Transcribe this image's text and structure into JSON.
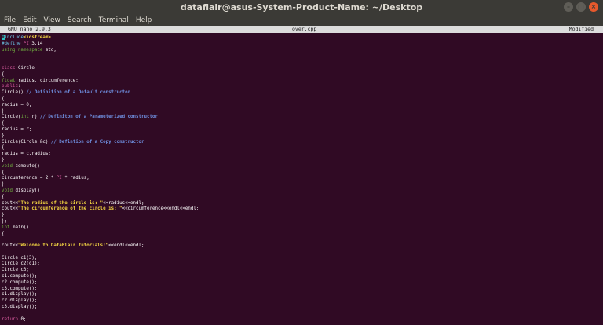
{
  "window": {
    "title": "dataflair@asus-System-Product-Name: ~/Desktop",
    "buttons": [
      "–",
      "□",
      "×"
    ]
  },
  "menu": [
    "File",
    "Edit",
    "View",
    "Search",
    "Terminal",
    "Help"
  ],
  "nano": {
    "version": "GNU nano 2.9.3",
    "filename": "over.cpp",
    "status": "Modified"
  },
  "code_lines": [
    [
      [
        "pre",
        "#include"
      ],
      [
        "str",
        "<iostream>"
      ]
    ],
    [
      [
        "pre",
        "#define "
      ],
      [
        "kw",
        "PI"
      ],
      [
        "pl",
        " 3.14"
      ]
    ],
    [
      [
        "ty",
        "using namespace"
      ],
      [
        "pl",
        " std;"
      ]
    ],
    [],
    [],
    [
      [
        "kw",
        "class"
      ],
      [
        "pl",
        " Circle"
      ]
    ],
    [
      [
        "pl",
        "{"
      ]
    ],
    [
      [
        "ty",
        "float"
      ],
      [
        "pl",
        " radius, circumference;"
      ]
    ],
    [
      [
        "kw",
        "public"
      ],
      [
        "pl",
        ":"
      ]
    ],
    [
      [
        "pl",
        "Circle() "
      ],
      [
        "cm",
        "// Definition of a Default constructor"
      ]
    ],
    [
      [
        "pl",
        "{"
      ]
    ],
    [
      [
        "pl",
        "radius = 0;"
      ]
    ],
    [
      [
        "pl",
        "}"
      ]
    ],
    [
      [
        "pl",
        "Circle("
      ],
      [
        "ty",
        "int"
      ],
      [
        "pl",
        " r) "
      ],
      [
        "cm",
        "// Definiton of a Parameterized constructor"
      ]
    ],
    [
      [
        "pl",
        "{"
      ]
    ],
    [
      [
        "pl",
        "radius = r;"
      ]
    ],
    [
      [
        "pl",
        "}"
      ]
    ],
    [
      [
        "pl",
        "Circle(Circle &c) "
      ],
      [
        "cm",
        "// Defintion of a Copy constructor"
      ]
    ],
    [
      [
        "pl",
        "{"
      ]
    ],
    [
      [
        "pl",
        "radius = c.radius;"
      ]
    ],
    [
      [
        "pl",
        "}"
      ]
    ],
    [
      [
        "ty",
        "void"
      ],
      [
        "pl",
        " compute()"
      ]
    ],
    [
      [
        "pl",
        "{"
      ]
    ],
    [
      [
        "pl",
        "circumference = 2 * "
      ],
      [
        "kw",
        "PI"
      ],
      [
        "pl",
        " * radius;"
      ]
    ],
    [
      [
        "pl",
        "}"
      ]
    ],
    [
      [
        "ty",
        "void"
      ],
      [
        "pl",
        " display()"
      ]
    ],
    [
      [
        "pl",
        "{"
      ]
    ],
    [
      [
        "pl",
        "cout<<"
      ],
      [
        "str",
        "\"The radius of the circle is: \""
      ],
      [
        "pl",
        "<<radius<<endl;"
      ]
    ],
    [
      [
        "pl",
        "cout<<"
      ],
      [
        "str",
        "\"The circumference of the circle is: \""
      ],
      [
        "pl",
        "<<circumference<<endl<<endl;"
      ]
    ],
    [
      [
        "pl",
        "}"
      ]
    ],
    [
      [
        "pl",
        "};"
      ]
    ],
    [
      [
        "ty",
        "int"
      ],
      [
        "pl",
        " main()"
      ]
    ],
    [
      [
        "pl",
        "{"
      ]
    ],
    [],
    [
      [
        "pl",
        "cout<<"
      ],
      [
        "str",
        "\"Welcome to DataFlair tutorials!\""
      ],
      [
        "pl",
        "<<endl<<endl;"
      ]
    ],
    [],
    [
      [
        "pl",
        "Circle c1(3);"
      ]
    ],
    [
      [
        "pl",
        "Circle c2(c1);"
      ]
    ],
    [
      [
        "pl",
        "Circle c3;"
      ]
    ],
    [
      [
        "pl",
        "c1.compute();"
      ]
    ],
    [
      [
        "pl",
        "c2.compute();"
      ]
    ],
    [
      [
        "pl",
        "c3.compute();"
      ]
    ],
    [
      [
        "pl",
        "c1.display();"
      ]
    ],
    [
      [
        "pl",
        "c2.display();"
      ]
    ],
    [
      [
        "pl",
        "c3.display();"
      ]
    ],
    [],
    [
      [
        "kw",
        "return"
      ],
      [
        "pl",
        " 0;"
      ]
    ],
    [
      [
        "pl",
        "}"
      ]
    ]
  ],
  "colors": {
    "terminal_bg": "#300a24",
    "titlebar_bg": "#3b3a36",
    "preprocessor": "#6fd0f0",
    "string": "#f5d742",
    "keyword": "#d4589c",
    "comment": "#6f8fe0",
    "type": "#70b040"
  }
}
